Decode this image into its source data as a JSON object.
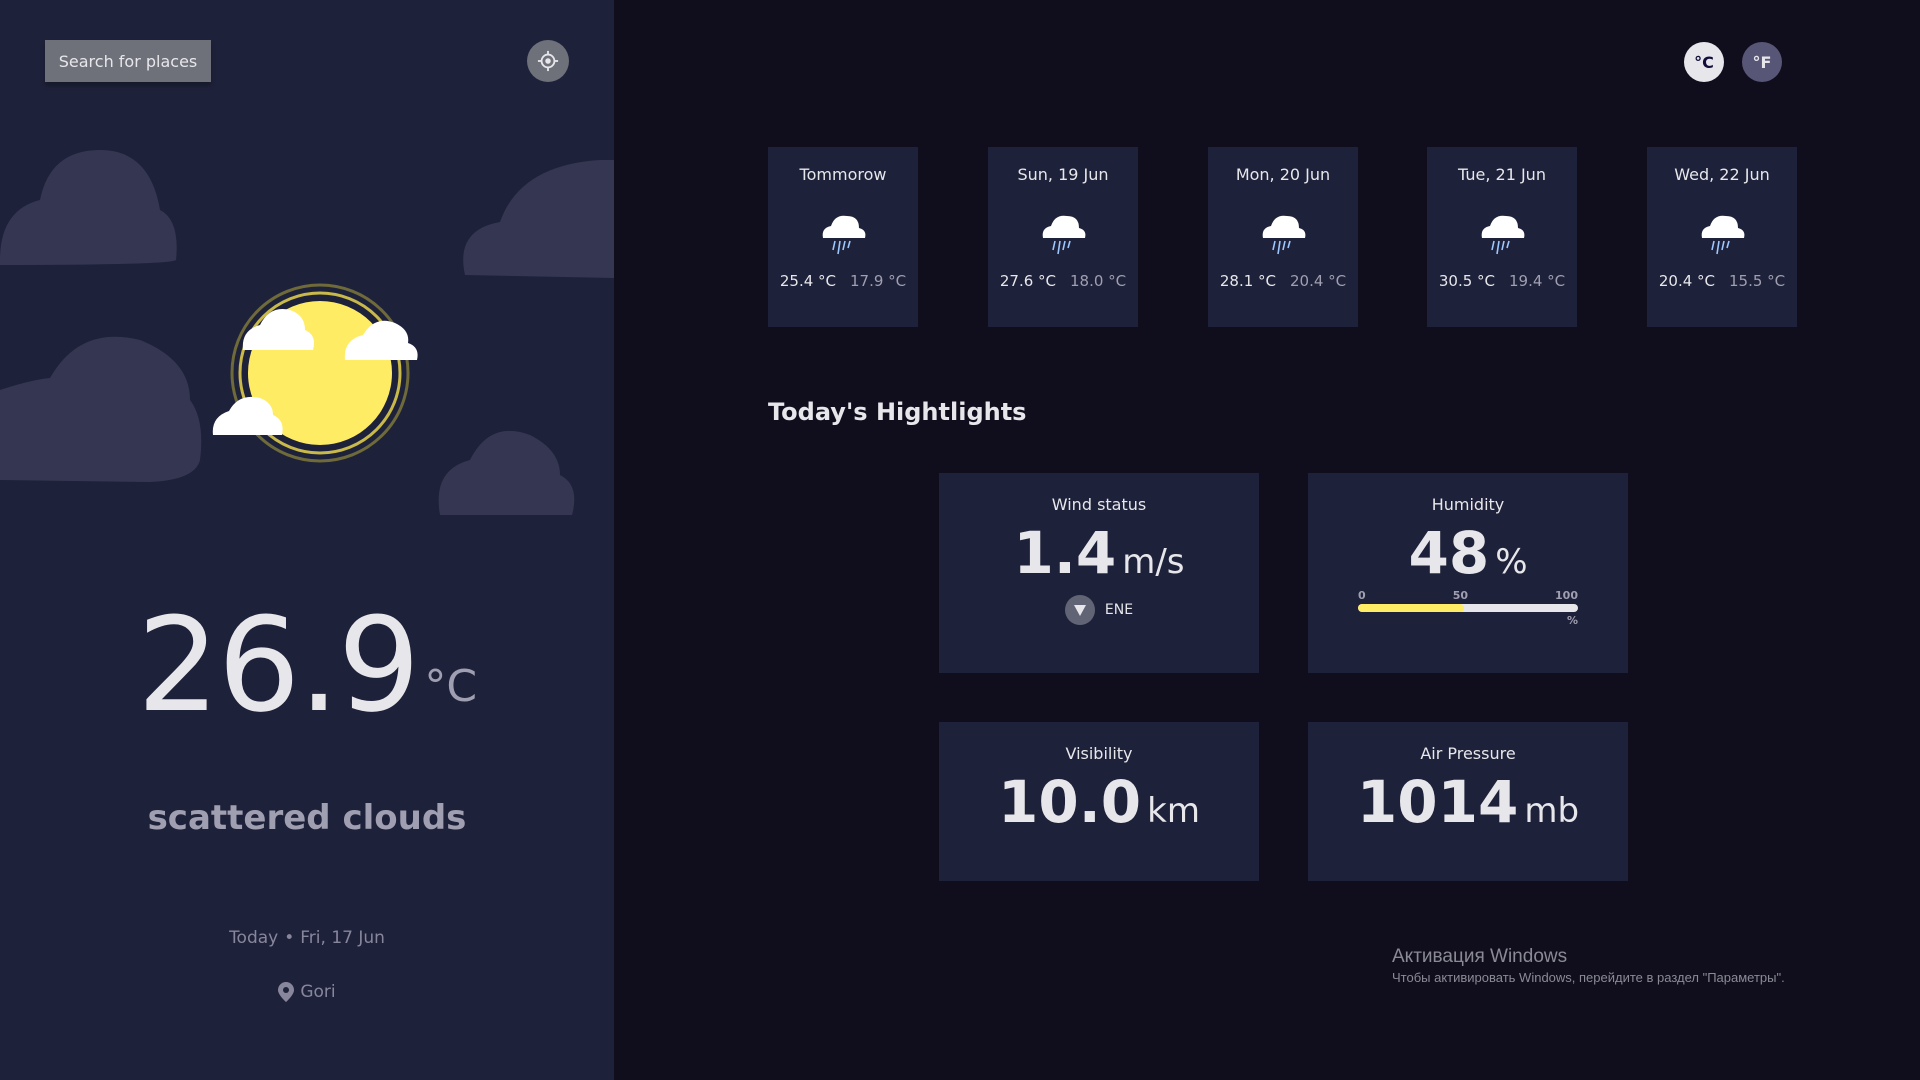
{
  "sidebar": {
    "search_label": "Search for places",
    "temperature": "26.9",
    "temperature_unit": "°C",
    "condition": "scattered clouds",
    "date_prefix": "Today",
    "date_separator": "•",
    "date": "Fri, 17 Jun",
    "location": "Gori",
    "icons": [
      "crosshair-icon",
      "cloud-icon",
      "sun-icon",
      "location-pin-icon"
    ]
  },
  "units": {
    "celsius_label": "°C",
    "fahrenheit_label": "°F",
    "active": "celsius"
  },
  "forecast": [
    {
      "day": "Tommorow",
      "max": "25.4 °C",
      "min": "17.9 °C",
      "icon": "rain-cloud-icon"
    },
    {
      "day": "Sun, 19 Jun",
      "max": "27.6 °C",
      "min": "18.0 °C",
      "icon": "rain-cloud-icon"
    },
    {
      "day": "Mon, 20 Jun",
      "max": "28.1 °C",
      "min": "20.4 °C",
      "icon": "rain-cloud-icon"
    },
    {
      "day": "Tue, 21 Jun",
      "max": "30.5 °C",
      "min": "19.4 °C",
      "icon": "rain-cloud-icon"
    },
    {
      "day": "Wed, 22 Jun",
      "max": "20.4 °C",
      "min": "15.5 °C",
      "icon": "rain-cloud-icon"
    }
  ],
  "highlights": {
    "title": "Today's Hightlights",
    "wind": {
      "title": "Wind status",
      "value": "1.4",
      "unit": "m/s",
      "direction": "ENE"
    },
    "humidity": {
      "title": "Humidity",
      "value": "48",
      "unit": "%",
      "scale": [
        "0",
        "50",
        "100"
      ],
      "scale_unit": "%",
      "percent": 48
    },
    "visibility": {
      "title": "Visibility",
      "value": "10.0",
      "unit": "km"
    },
    "pressure": {
      "title": "Air Pressure",
      "value": "1014",
      "unit": "mb"
    }
  },
  "watermark": {
    "title": "Активация Windows",
    "subtitle": "Чтобы активировать Windows, перейдите в раздел \"Параметры\"."
  },
  "colors": {
    "sidebar_bg": "#1e213a",
    "main_bg": "#100e1d",
    "card_bg": "#1e213a",
    "humidity_fill": "#ffec65",
    "sun": "#ffec65"
  }
}
